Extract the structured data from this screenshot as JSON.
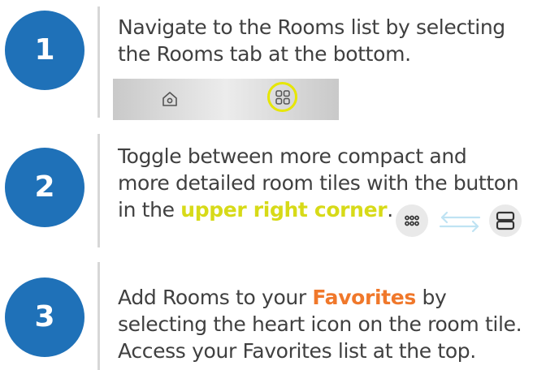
{
  "steps": [
    {
      "number": "1",
      "line1": "Navigate to the Rooms list by selecting",
      "line2": "the Rooms tab at the bottom."
    },
    {
      "number": "2",
      "line1": "Toggle between more compact and",
      "line2": "more detailed room tiles with the button",
      "line3_pre": "in the ",
      "line3_highlight": "upper right corner",
      "line3_post": "."
    },
    {
      "number": "3",
      "line1_pre": "Add Rooms to your ",
      "line1_highlight": "Favorites",
      "line1_post": " by",
      "line2": "selecting the heart icon on the room tile.",
      "line3": "Access your Favorites list at the top."
    }
  ],
  "icons": {
    "home": "home-icon",
    "rooms": "grid-icon",
    "compact": "compact-grid-icon",
    "swap": "swap-arrows-icon",
    "detailed": "list-rows-icon"
  },
  "colors": {
    "circle": "#1f71b8",
    "text": "#404040",
    "highlight_yellow": "#d7da18",
    "highlight_orange": "#f0782b",
    "ring": "#e6e600",
    "swap_arrows": "#bfe3f3"
  }
}
